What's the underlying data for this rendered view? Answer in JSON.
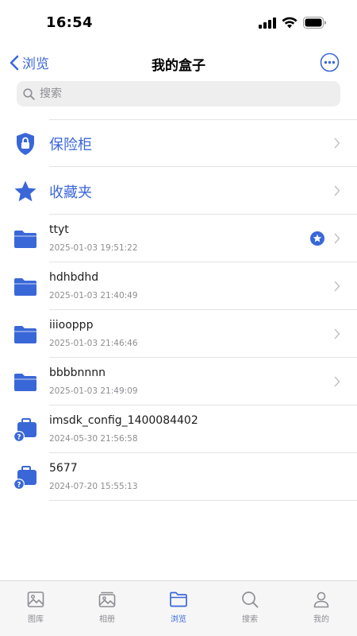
{
  "status_bar": {
    "time": "16:54"
  },
  "nav": {
    "back_label": "浏览",
    "title": "我的盒子"
  },
  "search": {
    "placeholder": "搜索",
    "value": ""
  },
  "special_items": [
    {
      "label": "保险柜",
      "icon": "shield-lock-icon"
    },
    {
      "label": "收藏夹",
      "icon": "star-icon"
    }
  ],
  "items": [
    {
      "name": "ttyt",
      "date": "2025-01-03 19:51:22",
      "icon": "folder-icon",
      "starred": true,
      "chevron": true
    },
    {
      "name": "hdhbdhd",
      "date": "2025-01-03 21:40:49",
      "icon": "folder-icon",
      "starred": false,
      "chevron": true
    },
    {
      "name": "iiiooppp",
      "date": "2025-01-03 21:46:46",
      "icon": "folder-icon",
      "starred": false,
      "chevron": true
    },
    {
      "name": "bbbbnnnn",
      "date": "2025-01-03 21:49:09",
      "icon": "folder-icon",
      "starred": false,
      "chevron": true
    },
    {
      "name": "imsdk_config_1400084402",
      "date": "2024-05-30 21:56:58",
      "icon": "unknown-file-icon",
      "starred": false,
      "chevron": false
    },
    {
      "name": "5677",
      "date": "2024-07-20 15:55:13",
      "icon": "unknown-file-icon",
      "starred": false,
      "chevron": false
    }
  ],
  "tabs": [
    {
      "label": "图库",
      "icon": "image-icon",
      "active": false
    },
    {
      "label": "相册",
      "icon": "album-icon",
      "active": false
    },
    {
      "label": "浏览",
      "icon": "folder-outline-icon",
      "active": true
    },
    {
      "label": "搜索",
      "icon": "search-icon",
      "active": false
    },
    {
      "label": "我的",
      "icon": "person-icon",
      "active": false
    }
  ],
  "colors": {
    "accent": "#3a67d8",
    "secondary_text": "#8e8e93",
    "divider": "#e3e3e6"
  }
}
